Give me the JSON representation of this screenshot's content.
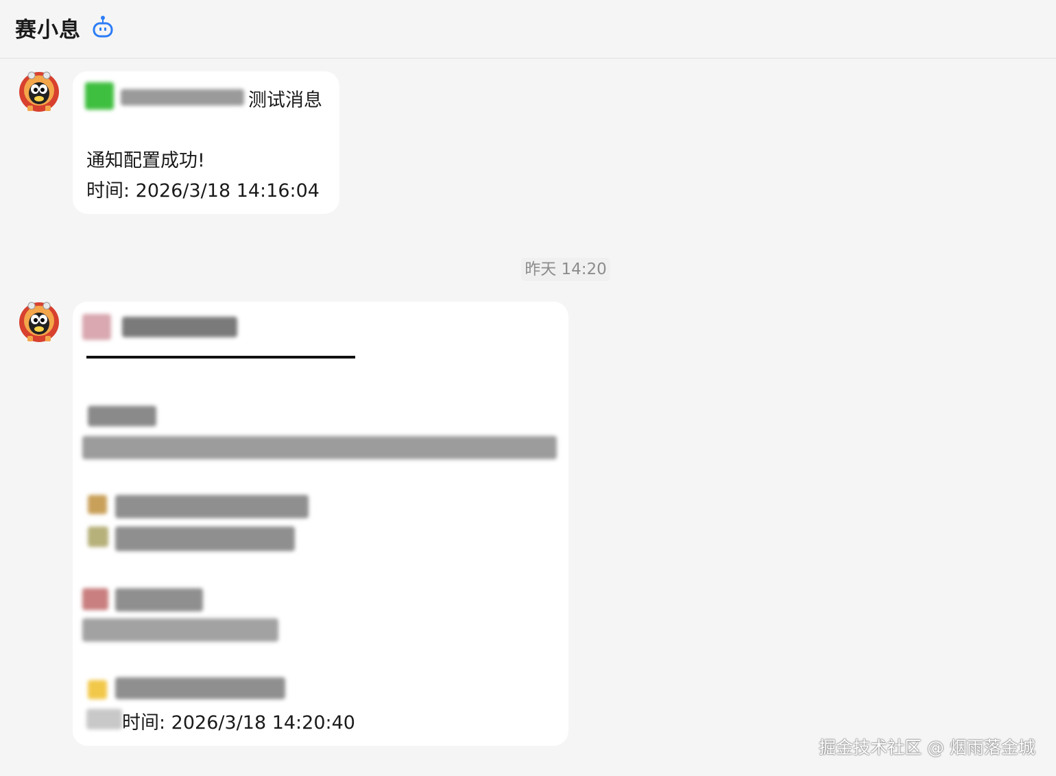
{
  "header": {
    "title": "赛小息",
    "bot_icon": "robot-icon",
    "accent_color": "#2b7cf6"
  },
  "messages": [
    {
      "avatar_icon": "bot-avatar-icon",
      "title_suffix": "测试消息",
      "body_line1": "通知配置成功!",
      "time_line": "时间: 2026/3/18 14:16:04"
    },
    {
      "avatar_icon": "bot-avatar-icon",
      "time_line": "时间: 2026/3/18 14:20:40"
    }
  ],
  "separator": {
    "label": "昨天 14:20"
  },
  "watermark": "掘金技术社区 @ 烟雨落金城"
}
